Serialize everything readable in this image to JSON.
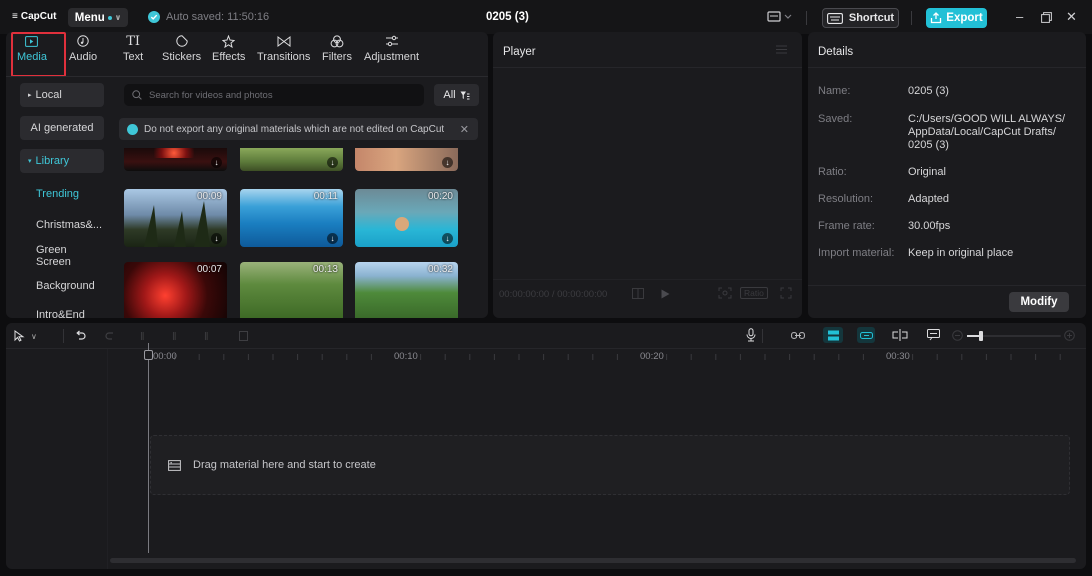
{
  "app": {
    "logo_text": "CapCut",
    "menu_label": "Menu",
    "autosave_text": "Auto saved: 11:50:16",
    "doc_title": "0205 (3)",
    "shortcut_label": "Shortcut",
    "export_label": "Export",
    "accent_color": "#22c0d6"
  },
  "tool_tabs": [
    {
      "label": "Media",
      "icon": "media-icon",
      "active": true
    },
    {
      "label": "Audio",
      "icon": "audio-icon"
    },
    {
      "label": "Text",
      "icon": "text-icon"
    },
    {
      "label": "Stickers",
      "icon": "stickers-icon"
    },
    {
      "label": "Effects",
      "icon": "effects-icon"
    },
    {
      "label": "Transitions",
      "icon": "transitions-icon"
    },
    {
      "label": "Filters",
      "icon": "filters-icon"
    },
    {
      "label": "Adjustment",
      "icon": "adjustment-icon"
    }
  ],
  "media_nav": {
    "local": "Local",
    "ai_generated": "AI generated",
    "library": "Library",
    "trending": "Trending",
    "christmas": "Christmas&...",
    "green_screen": "Green Screen",
    "background": "Background",
    "intro_end": "Intro&End"
  },
  "search": {
    "placeholder": "Search for videos and photos",
    "filter_label": "All"
  },
  "notice": {
    "text": "Do not export any original materials which are not edited on CapCut"
  },
  "thumbnails": {
    "row2": [
      {
        "duration": "00:09",
        "scene": "forest"
      },
      {
        "duration": "00:11",
        "scene": "ocean"
      },
      {
        "duration": "00:20",
        "scene": "pool"
      }
    ],
    "row3": [
      {
        "duration": "00:07",
        "scene": "fireworks"
      },
      {
        "duration": "00:13",
        "scene": "kids-park"
      },
      {
        "duration": "00:32",
        "scene": "hillside"
      }
    ]
  },
  "player": {
    "title": "Player",
    "time": "00:00:00:00 / 00:00:00:00",
    "ratio_label": "Ratio"
  },
  "details": {
    "title": "Details",
    "fields": [
      {
        "label": "Name:",
        "value": "0205 (3)"
      },
      {
        "label": "Saved:",
        "value": "C:/Users/GOOD WILL ALWAYS/ AppData/Local/CapCut Drafts/ 0205 (3)"
      },
      {
        "label": "Ratio:",
        "value": "Original"
      },
      {
        "label": "Resolution:",
        "value": "Adapted"
      },
      {
        "label": "Frame rate:",
        "value": "30.00fps"
      },
      {
        "label": "Import material:",
        "value": "Keep in original place"
      }
    ],
    "modify_label": "Modify"
  },
  "timeline": {
    "ruler": [
      "00:00",
      "00:10",
      "00:20",
      "00:30"
    ],
    "drop_text": "Drag material here and start to create"
  }
}
